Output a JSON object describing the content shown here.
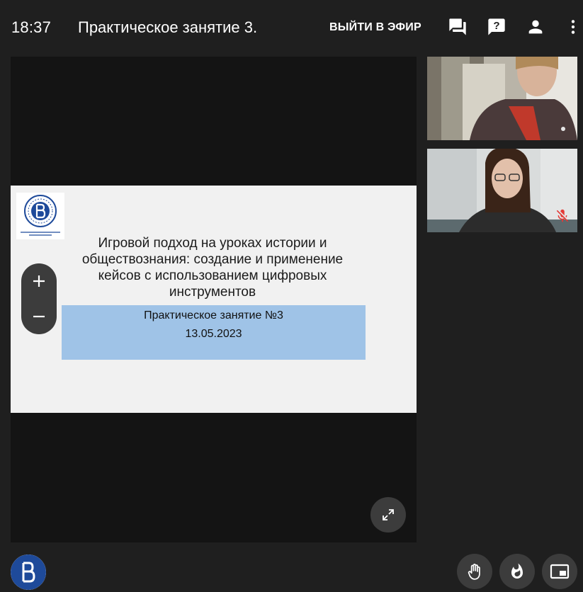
{
  "header": {
    "time": "18:37",
    "title": "Практическое занятие 3.",
    "on_air_label": "ВЫЙТИ В ЭФИР",
    "icons": [
      "chat-icon",
      "help-icon",
      "person-icon",
      "more-vert-icon"
    ]
  },
  "slide": {
    "title": "Игровой подход на уроках истории и обществознания: создание и применение кейсов с использованием цифровых инструментов",
    "subtitle": "Практическое занятие №3",
    "date": "13.05.2023"
  },
  "controls": {
    "zoom_in_icon": "plus-icon",
    "zoom_out_icon": "minus-icon",
    "expand_icon": "expand-icon",
    "bottom_icons": [
      "raise-hand-icon",
      "fire-icon",
      "picture-in-picture-icon"
    ]
  },
  "participants": [
    {
      "muted": false,
      "status_icon": "dot-icon"
    },
    {
      "muted": true,
      "status_icon": "mic-off-icon"
    }
  ],
  "colors": {
    "background": "#1f1f1f",
    "stage": "#141414",
    "slide_bg": "#f1f1f1",
    "slide_box": "#9fc3e7",
    "brand_blue": "#1e4a9a",
    "mute_red": "#e53935",
    "button_bg": "#3c3c3c"
  }
}
